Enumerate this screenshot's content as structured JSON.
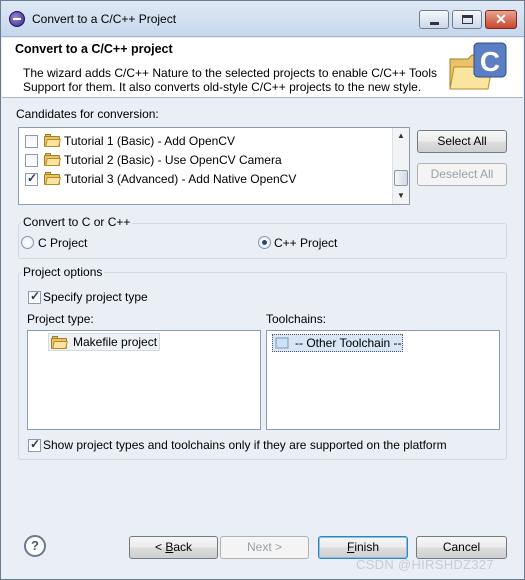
{
  "window": {
    "title": "Convert to a C/C++ Project"
  },
  "banner": {
    "title": "Convert to a C/C++ project",
    "description": "The wizard adds C/C++ Nature to the selected projects to enable C/C++ Tools Support for them. It also converts old-style C/C++ projects to the new style.",
    "graphic_letter": "C"
  },
  "candidates": {
    "label": "Candidates for conversion:",
    "items": [
      {
        "label": "Tutorial 1 (Basic) - Add OpenCV",
        "checked": false
      },
      {
        "label": "Tutorial 2 (Basic) - Use OpenCV Camera",
        "checked": false
      },
      {
        "label": "Tutorial 3 (Advanced) - Add Native OpenCV",
        "checked": true
      }
    ],
    "select_all": "Select All",
    "deselect_all": "Deselect All"
  },
  "convert": {
    "label": "Convert to C or C++",
    "c_project": "C Project",
    "cpp_project": "C++ Project",
    "selected": "cpp"
  },
  "options": {
    "label": "Project options",
    "specify_type": "Specify project type",
    "specify_checked": true,
    "project_type_label": "Project type:",
    "project_types": [
      "Makefile project"
    ],
    "toolchains_label": "Toolchains:",
    "toolchains": [
      "-- Other Toolchain --"
    ],
    "show_supported": "Show project types and toolchains only if they are supported on the platform",
    "show_supported_checked": true
  },
  "footer": {
    "help": "?",
    "back_prefix": "< ",
    "back_mnemonic": "B",
    "back_rest": "ack",
    "next": "Next >",
    "finish_mnemonic": "F",
    "finish_rest": "inish",
    "cancel": "Cancel"
  },
  "watermark": "CSDN @HIRSHDZ327"
}
